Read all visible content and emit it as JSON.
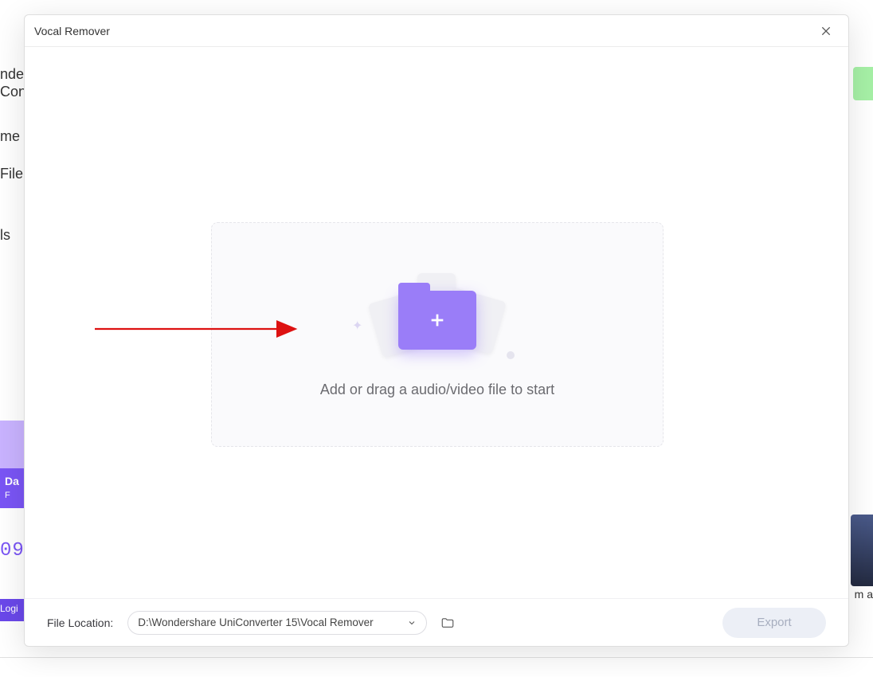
{
  "modal": {
    "title": "Vocal Remover"
  },
  "bg": {
    "frag1": "nder",
    "frag2": "Con",
    "frag3": "me",
    "frag4": "File",
    "frag5": "ls",
    "frag6": "Da",
    "frag7": "F",
    "frag8": "09",
    "frag9": "Logi",
    "frag10": "m a"
  },
  "dropzone": {
    "text": "Add or drag a audio/video file to start"
  },
  "footer": {
    "file_location_label": "File Location:",
    "file_location_path": "D:\\Wondershare UniConverter 15\\Vocal Remover",
    "export_label": "Export"
  }
}
